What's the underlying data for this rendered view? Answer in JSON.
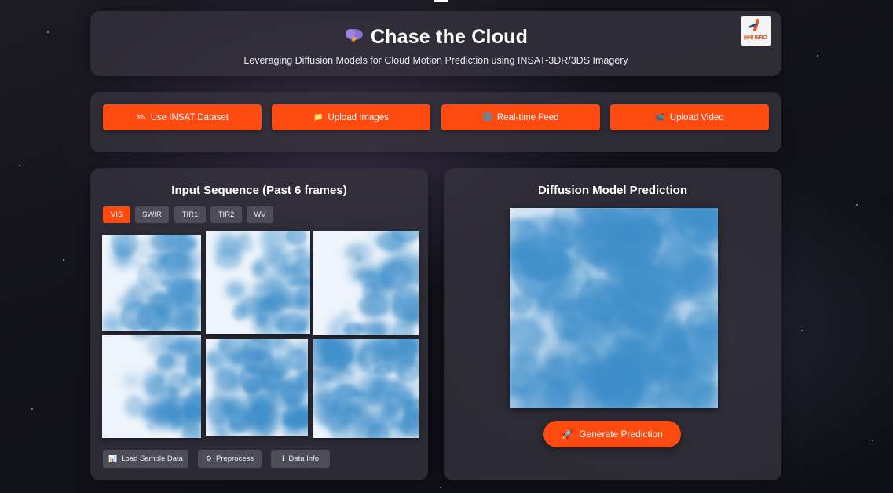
{
  "header": {
    "title": "Chase the Cloud",
    "title_icon": "storm-cloud-icon",
    "subtitle": "Leveraging Diffusion Models for Cloud Motion Prediction using INSAT-3DR/3DS Imagery",
    "logo": "isro-logo",
    "logo_text": "इसरो ISRO"
  },
  "actions": {
    "buttons": [
      {
        "label": "Use INSAT Dataset",
        "icon": "satellite-icon"
      },
      {
        "label": "Upload Images",
        "icon": "folder-icon"
      },
      {
        "label": "Real-time Feed",
        "icon": "globe-icon"
      },
      {
        "label": "Upload Video",
        "icon": "video-icon"
      }
    ]
  },
  "input_panel": {
    "title": "Input Sequence (Past 6 frames)",
    "tabs": [
      "VIS",
      "SWIR",
      "TIR1",
      "TIR2",
      "WV"
    ],
    "active_tab": "VIS",
    "frame_count": 6,
    "buttons": [
      {
        "label": "Load Sample Data",
        "icon": "chart-icon"
      },
      {
        "label": "Preprocess",
        "icon": "gear-icon"
      },
      {
        "label": "Data Info",
        "icon": "info-icon"
      }
    ]
  },
  "prediction_panel": {
    "title": "Diffusion Model Prediction",
    "button_label": "Generate Prediction",
    "button_icon": "rocket-icon"
  },
  "colors": {
    "accent": "#ff4a10",
    "panel": "#34323c",
    "cloud_blue": "#3f8fcb",
    "cloud_light": "#eef4fb"
  }
}
